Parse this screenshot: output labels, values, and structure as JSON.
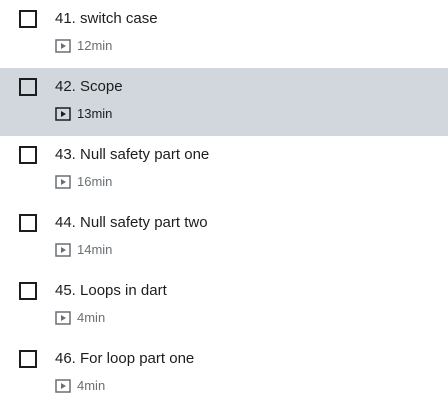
{
  "lectures": [
    {
      "title": "41. switch case",
      "duration": "12min",
      "active": false
    },
    {
      "title": "42. Scope",
      "duration": "13min",
      "active": true
    },
    {
      "title": "43. Null safety part one",
      "duration": "16min",
      "active": false
    },
    {
      "title": "44. Null safety part two",
      "duration": "14min",
      "active": false
    },
    {
      "title": "45. Loops in dart",
      "duration": "4min",
      "active": false
    },
    {
      "title": "46. For loop part one",
      "duration": "4min",
      "active": false
    }
  ],
  "icons": {
    "checkbox": "checkbox-icon",
    "video": "video-play-icon"
  },
  "colors": {
    "active_row_background": "#d1d7dc",
    "text": "#1c1d1f",
    "muted_text": "#6a6f73"
  }
}
